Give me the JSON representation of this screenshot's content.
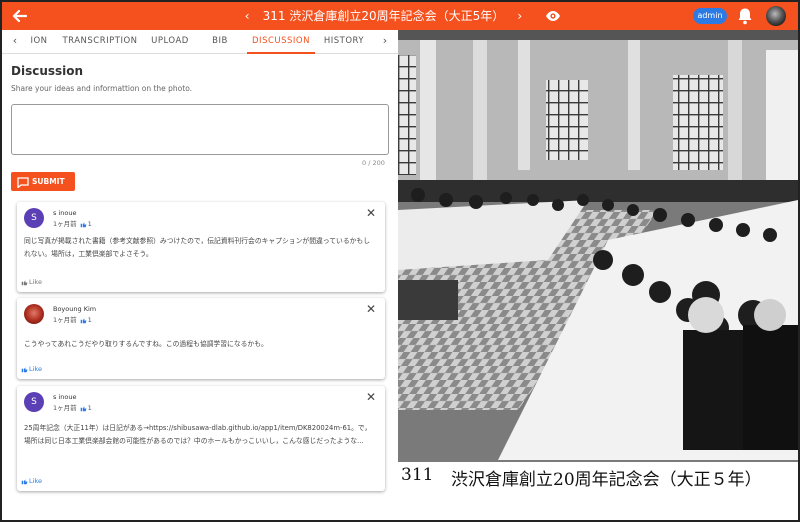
{
  "header": {
    "title": "311 渋沢倉庫創立20周年記念会（大正5年）",
    "admin_label": "admin"
  },
  "tabs": [
    {
      "label": "ION"
    },
    {
      "label": "TRANSCRIPTION"
    },
    {
      "label": "UPLOAD"
    },
    {
      "label": "BIB"
    },
    {
      "label": "DISCUSSION",
      "active": true
    },
    {
      "label": "HISTORY"
    }
  ],
  "discussion": {
    "title": "Discussion",
    "subtitle": "Share your ideas and informattion on the photo.",
    "counter": "0 / 200",
    "submit_label": "SUBMIT"
  },
  "comments": [
    {
      "avatar_letter": "S",
      "avatar_color": "#5b3fb5",
      "name": "s inoue",
      "time": "1ヶ月前",
      "likes": "1",
      "text": "同じ写真が掲載された書籍（参考文献参照）みつけたので，伝記資料刊行会のキャプションが間違っているかもしれない。場所は，工業倶楽部でよさそう。",
      "like_label": "Like"
    },
    {
      "avatar_letter": "",
      "avatar_color": "#c0392b",
      "name": "Boyoung Kim",
      "time": "1ヶ月前",
      "likes": "1",
      "text": "こうやってあれこうだやり取りするんですね。この過程も協調学習になるかも。",
      "like_label": "Like"
    },
    {
      "avatar_letter": "S",
      "avatar_color": "#5b3fb5",
      "name": "s inoue",
      "time": "1ヶ月前",
      "likes": "1",
      "text": "25周年記念（大正11年）は日記がある→https://shibusawa-dlab.github.io/app1/item/DK820024m-61。で，場所は同じ日本工業倶楽部会館の可能性があるのでは？中のホールもかっこいいし，こんな感じだったような...",
      "like_label": "Like"
    }
  ],
  "photo": {
    "caption_number": "311",
    "caption_text": "渋沢倉庫創立20周年記念会（大正５年）"
  }
}
